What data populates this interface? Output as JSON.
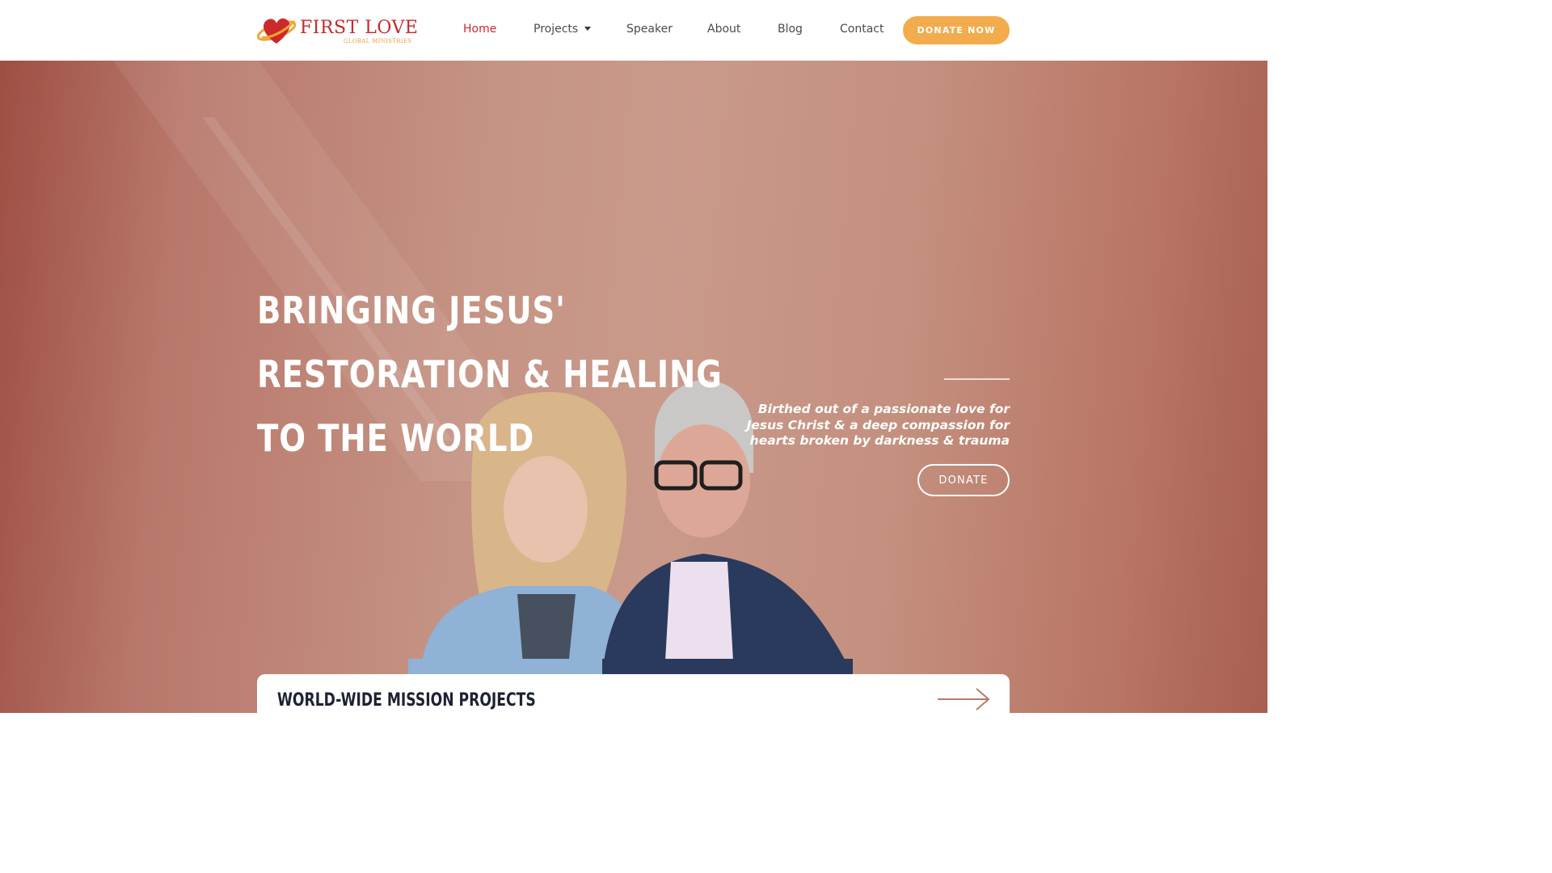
{
  "header": {
    "logo": {
      "name": "FIRST LOVE",
      "tagline": "GLOBAL MINISTRIES",
      "icon": "heart-icon"
    },
    "nav": [
      {
        "label": "Home",
        "active": true
      },
      {
        "label": "Projects",
        "has_dropdown": true
      },
      {
        "label": "Speaker"
      },
      {
        "label": "About"
      },
      {
        "label": "Blog"
      },
      {
        "label": "Contact"
      }
    ],
    "donate_button": "DONATE NOW"
  },
  "hero": {
    "title_lines": [
      "BRINGING JESUS'",
      "RESTORATION & HEALING",
      "TO THE WORLD"
    ],
    "tagline": "Birthed out of a passionate love for Jesus Christ & a deep compassion for hearts broken by darkness & trauma",
    "donate_button": "DONATE"
  },
  "mission_card": {
    "title": "WORLD-WIDE MISSION PROJECTS",
    "icon": "arrow-right-icon"
  },
  "colors": {
    "nav_active": "#d0262f",
    "donate_now_bg": "#f2ac4d",
    "hero_bg": "#c59484",
    "heading_dark": "#1d2233"
  }
}
